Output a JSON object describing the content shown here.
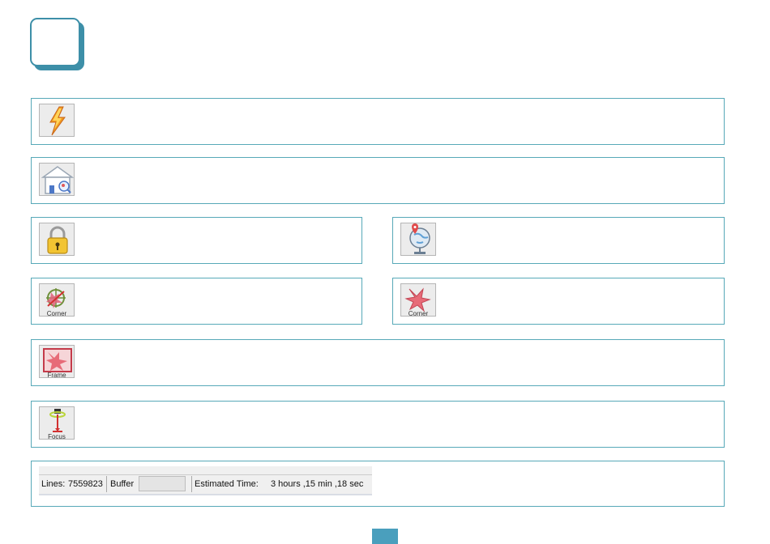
{
  "colors": {
    "accent": "#3d8fa8",
    "row_border": "#57a9b8",
    "pager": "#4a9fbd"
  },
  "rows": [
    {
      "name": "row-lightning",
      "icon": "lightning-icon"
    },
    {
      "name": "row-home-search",
      "icon": "home-search-icon"
    },
    {
      "name": "row-lock",
      "icon": "lock-icon"
    },
    {
      "name": "row-globe-location",
      "icon": "globe-location-icon"
    },
    {
      "name": "row-corner-target",
      "icon": "corner-target-icon",
      "caption": "Corner"
    },
    {
      "name": "row-corner-star",
      "icon": "corner-star-icon",
      "caption": "Corner"
    },
    {
      "name": "row-frame",
      "icon": "frame-icon",
      "caption": "Frame"
    },
    {
      "name": "row-focus",
      "icon": "focus-icon",
      "caption": "Focus"
    }
  ],
  "status_bar": {
    "lines_label": "Lines:",
    "lines_value": "7559823",
    "buffer_label": "Buffer",
    "estimated_label": "Estimated Time:",
    "estimated_value": "3 hours ,15 min ,18 sec"
  }
}
